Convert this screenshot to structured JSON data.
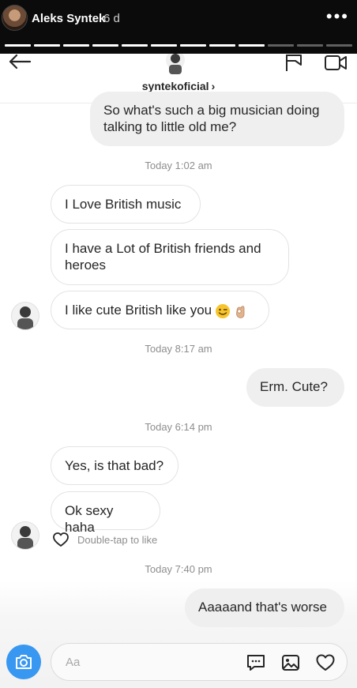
{
  "story": {
    "username": "Aleks Syntek",
    "time_ago": "6 d",
    "more_glyph": "•••",
    "progress": {
      "total": 12,
      "viewed": 9
    }
  },
  "dm": {
    "username": "syntekoficial",
    "chevron": "›"
  },
  "messages": [
    {
      "dir": "out",
      "text": "So what's such a big musician doing talking to little old me?"
    },
    {
      "timestamp": "Today 1:02 am"
    },
    {
      "dir": "in",
      "text": "I Love British music"
    },
    {
      "dir": "in",
      "text": "I have  a Lot of British friends and heroes"
    },
    {
      "dir": "in",
      "text": "I like cute British like you",
      "emoji": [
        "winking-face",
        "ok-hand"
      ]
    },
    {
      "timestamp": "Today 8:17 am"
    },
    {
      "dir": "out",
      "text": "Erm.  Cute?"
    },
    {
      "timestamp": "Today 6:14 pm"
    },
    {
      "dir": "in",
      "text": "Yes, is that bad?"
    },
    {
      "dir": "in",
      "text": "Ok sexy haha"
    },
    {
      "like_hint": "Double-tap to like"
    },
    {
      "timestamp": "Today 7:40 pm"
    },
    {
      "dir": "out",
      "text": "Aaaaand that's worse"
    }
  ],
  "composer": {
    "placeholder": "Aa",
    "icons": [
      "camera-icon",
      "chat-sticker-icon",
      "image-icon",
      "heart-icon"
    ]
  },
  "colors": {
    "story_bg": "#0b0b0b",
    "accent_blue": "#3897f0",
    "bubble_out": "#efefef",
    "bubble_in_border": "#e3e3e3",
    "timestamp": "#8e8e8e"
  }
}
